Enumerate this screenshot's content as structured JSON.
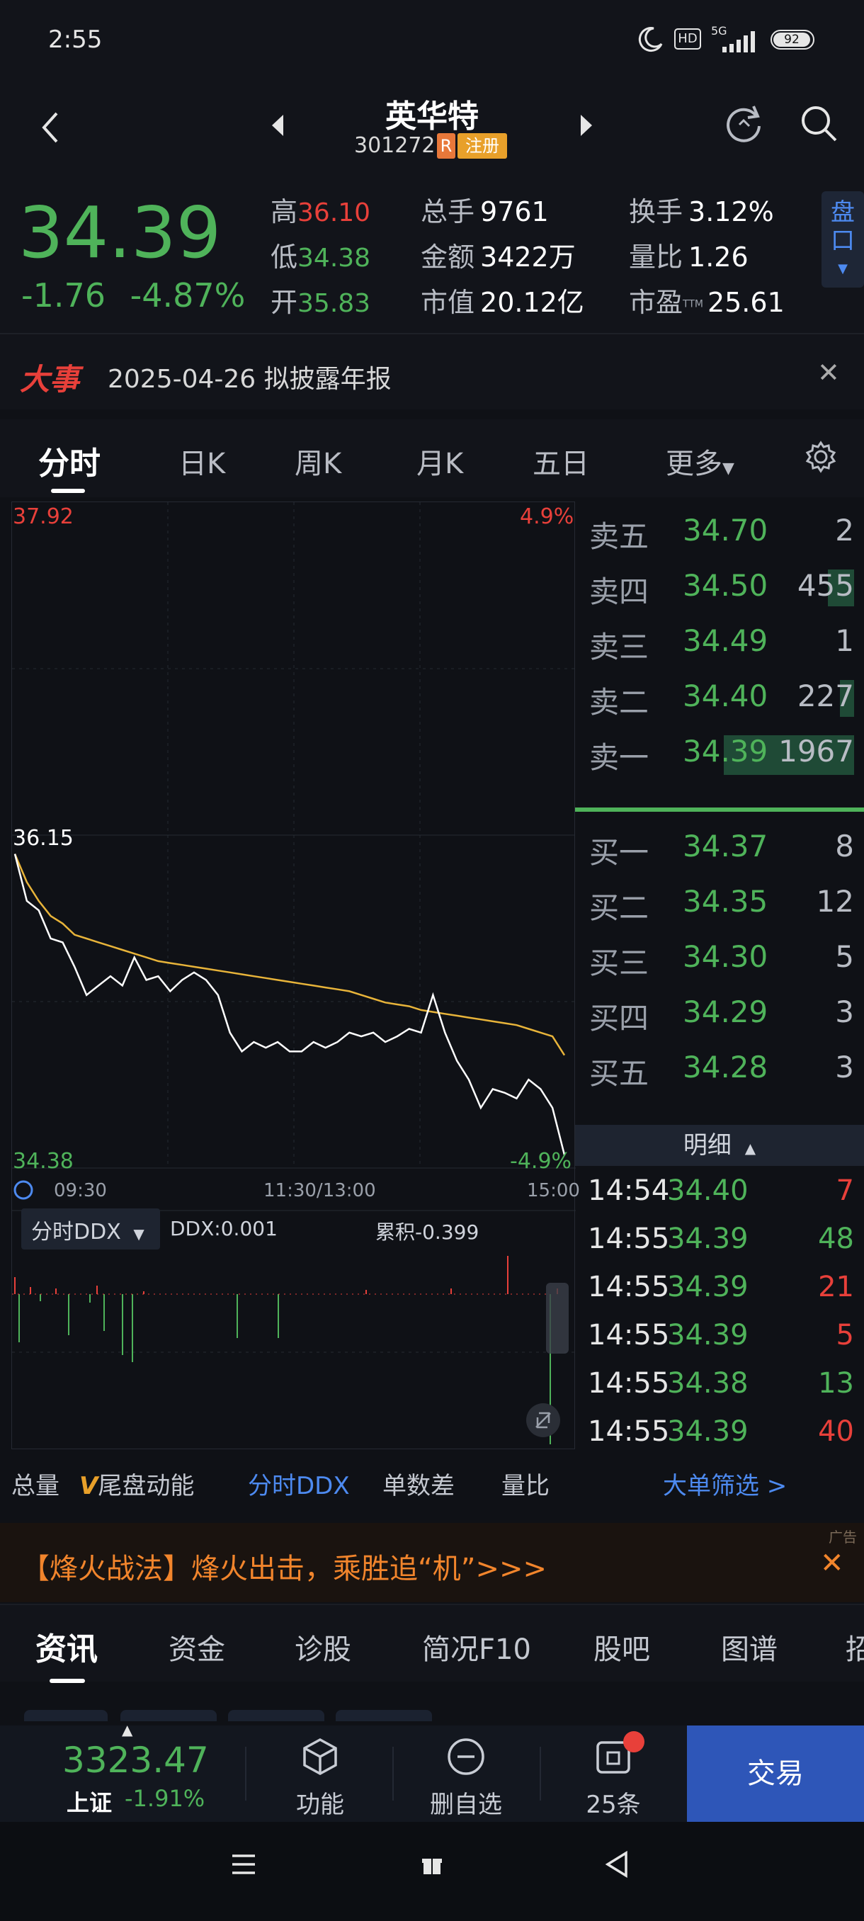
{
  "status": {
    "time": "2:55",
    "hd": "HD",
    "network": "5G",
    "battery": "92"
  },
  "header": {
    "name": "英华特",
    "code": "301272",
    "tag_r": "R",
    "tag_reg": "注册"
  },
  "quote": {
    "last_price": "34.39",
    "change": "-1.76",
    "change_pct": "-4.87%",
    "high_label": "高",
    "high": "36.10",
    "low_label": "低",
    "low": "34.38",
    "open_label": "开",
    "open": "35.83",
    "vol_label": "总手",
    "vol": "9761",
    "amount_label": "金额",
    "amount": "3422万",
    "mcap_label": "市值",
    "mcap": "20.12亿",
    "turnover_label": "换手",
    "turnover": "3.12%",
    "vratio_label": "量比",
    "vratio": "1.26",
    "pe_label": "市盈",
    "pe_sup": "TTM",
    "pe": "25.61",
    "pankou": "盘口"
  },
  "news": {
    "tag": "大事",
    "text": "2025-04-26 拟披露年报"
  },
  "period_tabs": [
    "分时",
    "日K",
    "周K",
    "月K",
    "五日",
    "更多"
  ],
  "chart": {
    "top_price": "37.92",
    "top_pct": "4.9%",
    "mid_price": "36.15",
    "bottom_price": "34.38",
    "bottom_pct": "-4.9%",
    "time_start": "09:30",
    "time_mid": "11:30/13:00",
    "time_end": "15:00",
    "ddx_select": "分时DDX",
    "ddx_value": "DDX:0.001",
    "ddx_cum": "累积-0.399"
  },
  "chart_data": {
    "type": "line",
    "ylim": [
      34.38,
      37.92
    ],
    "series": [
      {
        "name": "",
        "values": [
          36.05,
          35.8,
          35.75,
          35.6,
          35.58,
          35.45,
          35.3,
          35.35,
          35.4,
          35.35,
          35.5,
          35.38,
          35.4,
          35.32,
          35.38,
          35.42,
          35.38,
          35.3,
          35.1,
          35.0,
          35.05,
          35.02,
          35.05,
          35.0,
          35.0,
          35.05,
          35.02,
          35.05,
          35.1,
          35.08,
          35.1,
          35.05,
          35.08,
          35.12,
          35.1,
          35.3,
          35.1,
          34.95,
          34.85,
          34.7,
          34.8,
          34.78,
          34.75,
          34.85,
          34.8,
          34.7,
          34.45
        ]
      },
      {
        "name": "",
        "values": [
          36.05,
          35.9,
          35.8,
          35.72,
          35.68,
          35.62,
          35.6,
          35.58,
          35.56,
          35.54,
          35.52,
          35.5,
          35.48,
          35.47,
          35.46,
          35.45,
          35.44,
          35.43,
          35.42,
          35.41,
          35.4,
          35.39,
          35.38,
          35.37,
          35.36,
          35.35,
          35.34,
          35.33,
          35.32,
          35.3,
          35.28,
          35.26,
          35.25,
          35.24,
          35.22,
          35.21,
          35.2,
          35.19,
          35.18,
          35.17,
          35.16,
          35.15,
          35.14,
          35.12,
          35.1,
          35.08,
          34.98
        ]
      }
    ]
  },
  "orderbook": {
    "asks": [
      {
        "label": "卖五",
        "price": "34.70",
        "vol": "2",
        "bar": 0.0
      },
      {
        "label": "卖四",
        "price": "34.50",
        "vol": "455",
        "bar": 0.09
      },
      {
        "label": "卖三",
        "price": "34.49",
        "vol": "1",
        "bar": 0.0
      },
      {
        "label": "卖二",
        "price": "34.40",
        "vol": "227",
        "bar": 0.05
      },
      {
        "label": "卖一",
        "price": "34.39",
        "vol": "1967",
        "bar": 0.45
      }
    ],
    "bids": [
      {
        "label": "买一",
        "price": "34.37",
        "vol": "8"
      },
      {
        "label": "买二",
        "price": "34.35",
        "vol": "12"
      },
      {
        "label": "买三",
        "price": "34.30",
        "vol": "5"
      },
      {
        "label": "买四",
        "price": "34.29",
        "vol": "3"
      },
      {
        "label": "买五",
        "price": "34.28",
        "vol": "3"
      }
    ]
  },
  "detail": {
    "header": "明细",
    "ticks": [
      {
        "time": "14:54",
        "price": "34.40",
        "vol": "7",
        "dir": "red"
      },
      {
        "time": "14:55",
        "price": "34.39",
        "vol": "48",
        "dir": "green"
      },
      {
        "time": "14:55",
        "price": "34.39",
        "vol": "21",
        "dir": "red"
      },
      {
        "time": "14:55",
        "price": "34.39",
        "vol": "5",
        "dir": "red"
      },
      {
        "time": "14:55",
        "price": "34.38",
        "vol": "13",
        "dir": "green"
      },
      {
        "time": "14:55",
        "price": "34.39",
        "vol": "40",
        "dir": "red"
      }
    ]
  },
  "indicator_tabs": {
    "t1": "总量",
    "t2_v": "V",
    "t2": "尾盘动能",
    "t3": "分时DDX",
    "t4": "单数差",
    "t5": "量比",
    "filter": "大单筛选 >"
  },
  "ad": {
    "text": "【烽火战法】烽火出击，乘胜追“机”>>>",
    "mark": "广告"
  },
  "bottom_tabs": [
    "资讯",
    "资金",
    "诊股",
    "简况F10",
    "股吧",
    "图谱",
    "招"
  ],
  "footer": {
    "index_value": "3323.47",
    "index_name": "上证",
    "index_change": "-1.91%",
    "btn_func": "功能",
    "btn_remove": "删自选",
    "btn_ask": "25条",
    "btn_trade": "交易"
  },
  "colors": {
    "up": "#e8403a",
    "down": "#4fb35a",
    "avg_line": "#e8b43a",
    "price_line": "#ffffff",
    "accent": "#2e56b8"
  }
}
